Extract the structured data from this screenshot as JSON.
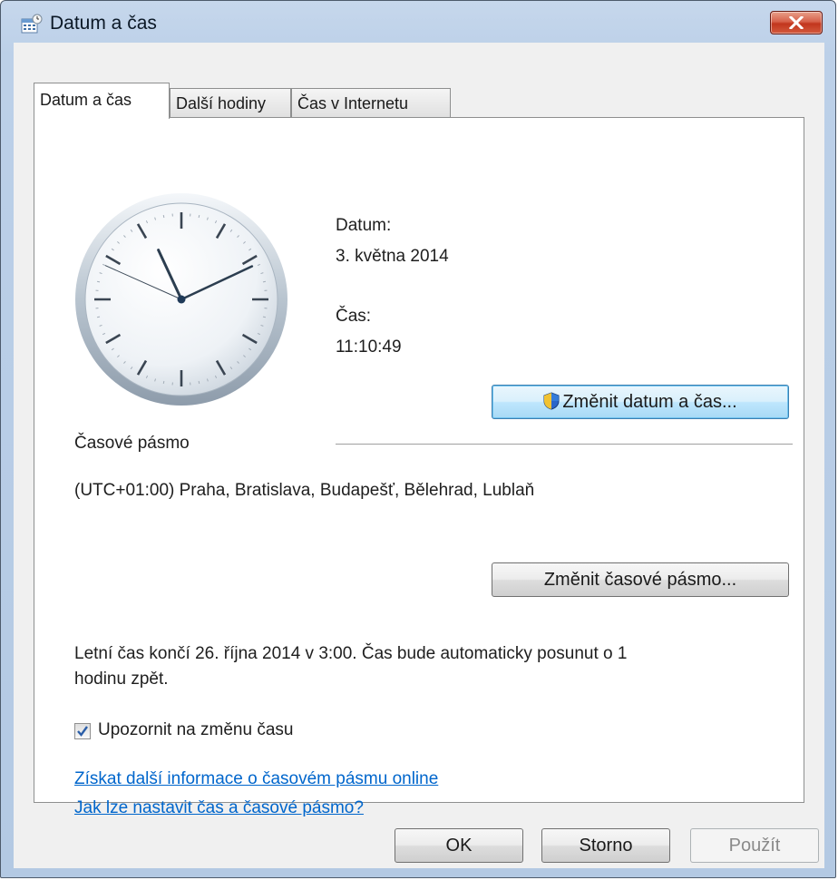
{
  "window": {
    "title": "Datum a čas"
  },
  "tabs": [
    {
      "label": "Datum a čas",
      "active": true
    },
    {
      "label": "Další hodiny",
      "active": false
    },
    {
      "label": "Čas v Internetu",
      "active": false
    }
  ],
  "datetime": {
    "date_label": "Datum:",
    "date_value": "3. května 2014",
    "time_label": "Čas:",
    "time_value": "11:10:49",
    "change_button": "Změnit datum a čas..."
  },
  "timezone": {
    "section_label": "Časové pásmo",
    "value": "(UTC+01:00) Praha, Bratislava, Budapešť, Bělehrad, Lublaň",
    "change_button": "Změnit časové pásmo..."
  },
  "dst": {
    "line1": "Letní čas končí 26. října 2014 v 3:00. Čas bude automaticky posunut o 1",
    "line2": "hodinu zpět.",
    "notify_label": "Upozornit na změnu času",
    "notify_checked": true
  },
  "links": {
    "more_info": "Získat další informace o časovém pásmu online",
    "how_to": "Jak lze nastavit čas a časové pásmo?"
  },
  "footer": {
    "ok": "OK",
    "cancel": "Storno",
    "apply": "Použít"
  },
  "icons": {
    "title": "calendar-clock-icon",
    "close": "close-icon",
    "shield": "uac-shield-icon",
    "check": "checkmark-icon"
  },
  "colors": {
    "link": "#0066cc",
    "close_button": "#c2361d",
    "focused_button": "#a7d9f5"
  }
}
